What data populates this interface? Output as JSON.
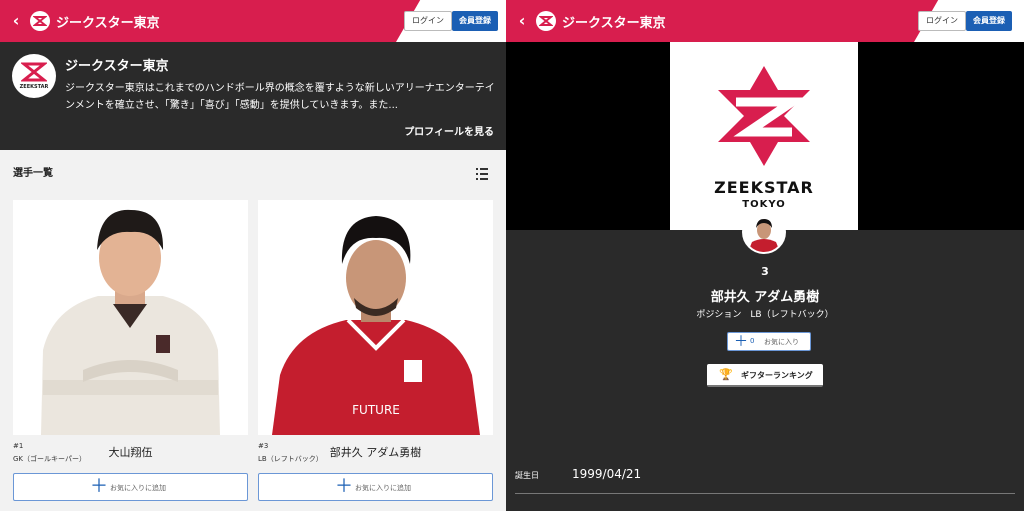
{
  "left": {
    "header": {
      "title": "ジークスター東京",
      "login": "ログイン",
      "register": "会員登録"
    },
    "profile": {
      "name": "ジークスター東京",
      "description": "ジークスター東京はこれまでのハンドボール界の概念を覆すような新しいアリーナエンターテインメントを確立させ、「驚き」「喜び」「感動」を提供していきます。また...",
      "link": "プロフィールを見る",
      "logo_text": "ZEEKSTAR"
    },
    "roster": {
      "title": "選手一覧",
      "players": [
        {
          "number": "#1",
          "position": "GK（ゴールキーパー）",
          "name": "大山翔伍",
          "fav": "お気に入りに追加"
        },
        {
          "number": "#3",
          "position": "LB（レフトバック）",
          "name": "部井久 アダム勇樹",
          "fav": "お気に入りに追加"
        }
      ]
    }
  },
  "right": {
    "header": {
      "title": "ジークスター東京",
      "login": "ログイン",
      "register": "会員登録"
    },
    "hero": {
      "brand": "ZEEKSTAR",
      "sub": "TOKYO"
    },
    "player": {
      "number": "3",
      "name": "部井久 アダム勇樹",
      "position": "ポジション　LB（レフトバック）",
      "fav_count": "0",
      "fav_label": "お気に入り",
      "gift_label": "ギフターランキング",
      "dob_label": "誕生日",
      "dob_value": "1999/04/21"
    }
  },
  "colors": {
    "brand": "#d81e4e",
    "accent": "#1b5fb4",
    "dark": "#2a2a2a"
  }
}
